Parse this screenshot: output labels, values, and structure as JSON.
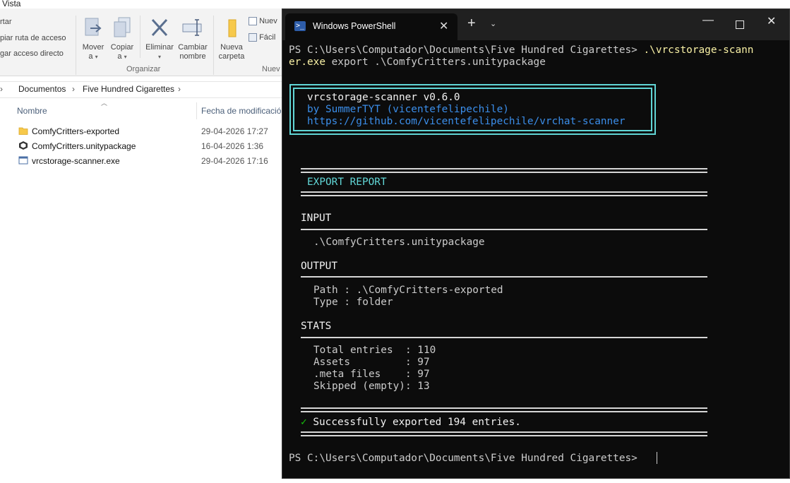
{
  "explorer": {
    "menu_vista": "Vista",
    "ribbon": {
      "left_items": [
        "rtar",
        "piar ruta de acceso",
        "gar acceso directo"
      ],
      "mover_label": "Mover",
      "mover_sub": "a",
      "copiar_label": "Copiar",
      "copiar_sub": "a",
      "eliminar_label": "Eliminar",
      "cambiar_label": "Cambiar",
      "cambiar_sub": "nombre",
      "nueva_label": "Nueva",
      "nueva_sub": "carpeta",
      "nuevo_item": "Nuev",
      "facil_item": "Fácil",
      "group_organizar": "Organizar",
      "group_nuevo": "Nuev"
    },
    "breadcrumb": [
      "Documentos",
      "Five Hundred Cigarettes"
    ],
    "columns": {
      "name": "Nombre",
      "date": "Fecha de modificació"
    },
    "files": [
      {
        "name": "ComfyCritters-exported",
        "date": "29-04-2026 17:27",
        "icon": "folder-icon"
      },
      {
        "name": "ComfyCritters.unitypackage",
        "date": "16-04-2026 1:36",
        "icon": "unity-package-icon"
      },
      {
        "name": "vrcstorage-scanner.exe",
        "date": "29-04-2026 17:16",
        "icon": "exe-icon"
      }
    ]
  },
  "terminal": {
    "tab_title": "Windows PowerShell",
    "prompt": "PS C:\\Users\\Computador\\Documents\\Five Hundred Cigarettes> ",
    "command_part1": ".\\vrcstorage-scann",
    "command_part2": "er.exe",
    "command_args": " export .\\ComfyCritters.unitypackage",
    "banner": {
      "line1": "vrcstorage-scanner v0.6.0",
      "line2": "by SummerTYT (vicentefelipechile)",
      "line3": "https://github.com/vicentefelipechile/vrchat-scanner"
    },
    "report_title": "EXPORT REPORT",
    "input_header": "INPUT",
    "input_value": ".\\ComfyCritters.unitypackage",
    "output_header": "OUTPUT",
    "output_path": "Path : .\\ComfyCritters-exported",
    "output_type": "Type : folder",
    "stats_header": "STATS",
    "stats": [
      "Total entries  : 110",
      "Assets         : 97",
      ".meta files    : 97",
      "Skipped (empty): 13"
    ],
    "success_mark": "✓",
    "success_text": " Successfully exported 194 entries.",
    "final_prompt": "PS C:\\Users\\Computador\\Documents\\Five Hundred Cigarettes> "
  },
  "colors": {
    "terminal_bg": "#0c0c0c",
    "cyan": "#61d6d6",
    "yellow": "#f9f1a5",
    "blue": "#3b8eea",
    "green": "#16c60c"
  }
}
